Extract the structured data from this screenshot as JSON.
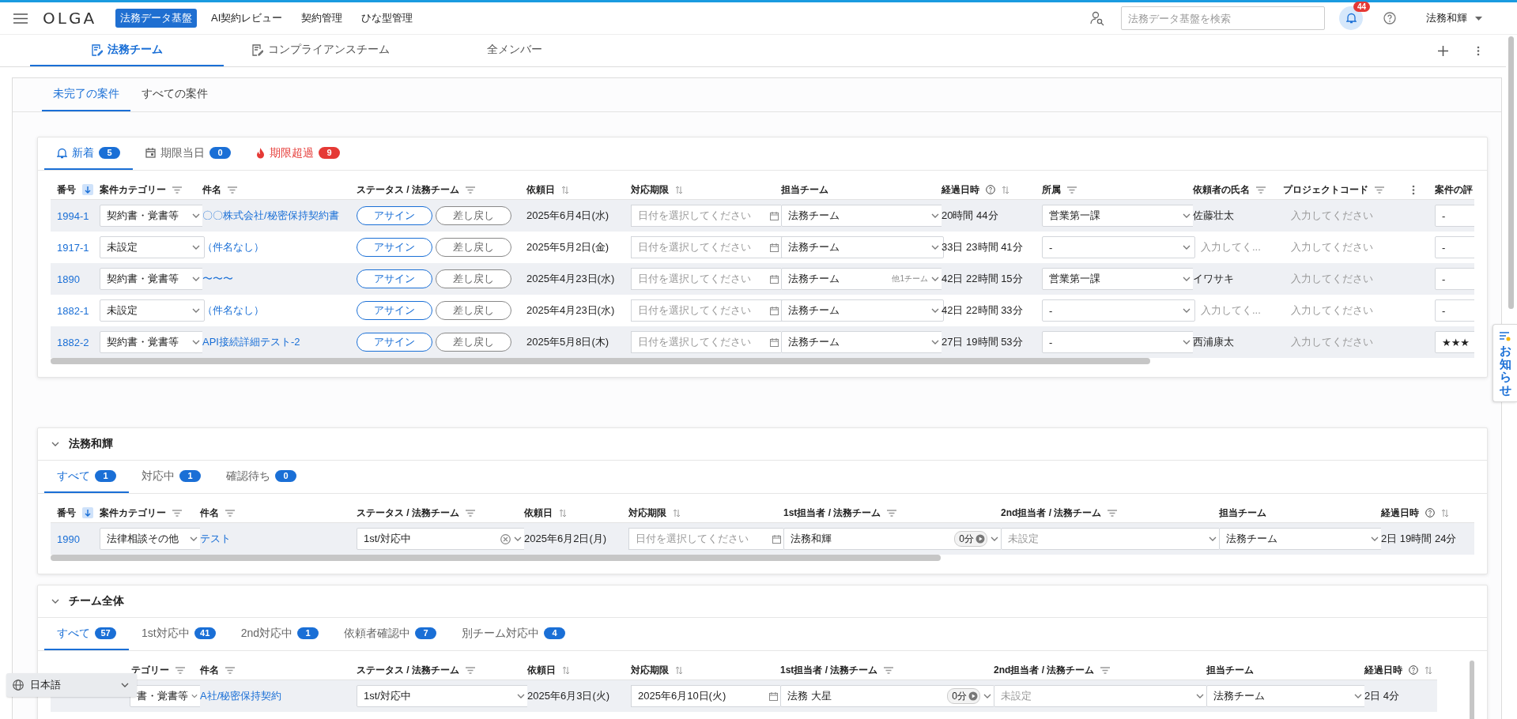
{
  "header": {
    "logo": "OLGA",
    "nav": [
      {
        "label": "法務データ基盤",
        "selected": true
      },
      {
        "label": "AI契約レビュー",
        "selected": false
      },
      {
        "label": "契約管理",
        "selected": false
      },
      {
        "label": "ひな型管理",
        "selected": false
      }
    ],
    "search": {
      "placeholder": "法務データ基盤を検索"
    },
    "notification_count": "44",
    "user": "法務和輝"
  },
  "team_tabs": [
    {
      "label": "法務チーム",
      "selected": true,
      "icon": true
    },
    {
      "label": "コンプライアンスチーム",
      "selected": false,
      "icon": true
    },
    {
      "label": "全メンバー",
      "selected": false,
      "icon": false
    }
  ],
  "view_tabs": [
    {
      "label": "未完了の案件",
      "selected": true
    },
    {
      "label": "すべての案件",
      "selected": false
    }
  ],
  "cards": [
    {
      "tabs": [
        {
          "label": "新着",
          "count": "5",
          "kind": "bell",
          "selected": true
        },
        {
          "label": "期限当日",
          "count": "0",
          "kind": "calendar",
          "selected": false
        },
        {
          "label": "期限超過",
          "count": "9",
          "kind": "overdue",
          "selected": false
        }
      ],
      "columns": [
        {
          "label": "番号",
          "sorted": true
        },
        {
          "label": "案件カテゴリー",
          "filter": true
        },
        {
          "label": "件名",
          "filter": true
        },
        {
          "label": "ステータス / 法務チーム",
          "filter": true
        },
        {
          "label": "依頼日",
          "sortable": true
        },
        {
          "label": "対応期限",
          "sortable": true
        },
        {
          "label": "担当チーム"
        },
        {
          "label": "経過日時",
          "help": true,
          "sortable": true
        },
        {
          "label": "所属",
          "filter": true
        },
        {
          "label": "依頼者の氏名",
          "filter": true
        },
        {
          "label": "プロジェクトコード",
          "filter": true,
          "menu": true
        },
        {
          "label": "案件の評"
        }
      ],
      "rows": [
        {
          "cells": [
            {
              "kind": "link",
              "text": "1994-1"
            },
            {
              "kind": "select",
              "value": "契約書・覚書等"
            },
            {
              "kind": "link",
              "text": "〇〇株式会社/秘密保持契約書"
            },
            {
              "kind": "actions",
              "buttons": [
                {
                  "label": "アサイン",
                  "kind": "primary"
                },
                {
                  "label": "差し戻し",
                  "kind": "secondary"
                }
              ]
            },
            {
              "kind": "text",
              "text": "2025年6月4日(水)"
            },
            {
              "kind": "date",
              "placeholder": "日付を選択してください"
            },
            {
              "kind": "select",
              "value": "法務チーム"
            },
            {
              "kind": "text",
              "text": "20時間 44分"
            },
            {
              "kind": "select",
              "value": "営業第一課"
            },
            {
              "kind": "text",
              "text": "佐藤壮太"
            },
            {
              "kind": "input",
              "placeholder": "入力してください"
            },
            {
              "kind": "select",
              "value": "-"
            }
          ]
        },
        {
          "cells": [
            {
              "kind": "link",
              "text": "1917-1"
            },
            {
              "kind": "select",
              "value": "未設定"
            },
            {
              "kind": "link",
              "text": "（件名なし）"
            },
            {
              "kind": "actions",
              "buttons": [
                {
                  "label": "アサイン",
                  "kind": "primary"
                },
                {
                  "label": "差し戻し",
                  "kind": "secondary"
                }
              ]
            },
            {
              "kind": "text",
              "text": "2025年5月2日(金)"
            },
            {
              "kind": "date",
              "placeholder": "日付を選択してください"
            },
            {
              "kind": "select",
              "value": "法務チーム"
            },
            {
              "kind": "text",
              "text": "33日 23時間 41分"
            },
            {
              "kind": "select",
              "value": "-"
            },
            {
              "kind": "input",
              "placeholder": "入力してく..."
            },
            {
              "kind": "input",
              "placeholder": "入力してください"
            },
            {
              "kind": "select",
              "value": "-"
            }
          ]
        },
        {
          "cells": [
            {
              "kind": "link",
              "text": "1890"
            },
            {
              "kind": "select",
              "value": "契約書・覚書等"
            },
            {
              "kind": "link",
              "text": "〜〜〜"
            },
            {
              "kind": "actions",
              "buttons": [
                {
                  "label": "アサイン",
                  "kind": "primary"
                },
                {
                  "label": "差し戻し",
                  "kind": "secondary"
                }
              ]
            },
            {
              "kind": "text",
              "text": "2025年4月23日(水)"
            },
            {
              "kind": "date",
              "placeholder": "日付を選択してください"
            },
            {
              "kind": "select",
              "value": "法務チーム",
              "extra": "他1チーム"
            },
            {
              "kind": "text",
              "text": "42日 22時間 15分"
            },
            {
              "kind": "select",
              "value": "営業第一課"
            },
            {
              "kind": "text",
              "text": "イワサキ"
            },
            {
              "kind": "input",
              "placeholder": "入力してください"
            },
            {
              "kind": "select",
              "value": "-"
            }
          ]
        },
        {
          "cells": [
            {
              "kind": "link",
              "text": "1882-1"
            },
            {
              "kind": "select",
              "value": "未設定"
            },
            {
              "kind": "link",
              "text": "（件名なし）"
            },
            {
              "kind": "actions",
              "buttons": [
                {
                  "label": "アサイン",
                  "kind": "primary"
                },
                {
                  "label": "差し戻し",
                  "kind": "secondary"
                }
              ]
            },
            {
              "kind": "text",
              "text": "2025年4月23日(水)"
            },
            {
              "kind": "date",
              "placeholder": "日付を選択してください"
            },
            {
              "kind": "select",
              "value": "法務チーム"
            },
            {
              "kind": "text",
              "text": "42日 22時間 33分"
            },
            {
              "kind": "select",
              "value": "-"
            },
            {
              "kind": "input",
              "placeholder": "入力してく..."
            },
            {
              "kind": "input",
              "placeholder": "入力してください"
            },
            {
              "kind": "select",
              "value": "-"
            }
          ]
        },
        {
          "cells": [
            {
              "kind": "link",
              "text": "1882-2"
            },
            {
              "kind": "select",
              "value": "契約書・覚書等"
            },
            {
              "kind": "link",
              "text": "API接続詳細テスト-2"
            },
            {
              "kind": "actions",
              "buttons": [
                {
                  "label": "アサイン",
                  "kind": "primary"
                },
                {
                  "label": "差し戻し",
                  "kind": "secondary"
                }
              ]
            },
            {
              "kind": "text",
              "text": "2025年5月8日(木)"
            },
            {
              "kind": "date",
              "placeholder": "日付を選択してください"
            },
            {
              "kind": "select",
              "value": "法務チーム"
            },
            {
              "kind": "text",
              "text": "27日 19時間 53分"
            },
            {
              "kind": "select",
              "value": "-"
            },
            {
              "kind": "text",
              "text": "西浦康太"
            },
            {
              "kind": "input",
              "placeholder": "入力してください"
            },
            {
              "kind": "select",
              "value": "★★★"
            }
          ]
        }
      ]
    },
    {
      "title": "法務和輝",
      "expanded": true,
      "tabs": [
        {
          "label": "すべて",
          "count": "1",
          "kind": "plain",
          "selected": true
        },
        {
          "label": "対応中",
          "count": "1",
          "kind": "plain",
          "selected": false
        },
        {
          "label": "確認待ち",
          "count": "0",
          "kind": "plain",
          "selected": false
        }
      ],
      "columns": [
        {
          "label": "番号",
          "sorted": true
        },
        {
          "label": "案件カテゴリー",
          "filter": true
        },
        {
          "label": "件名",
          "filter": true
        },
        {
          "label": "ステータス / 法務チーム",
          "filter": true
        },
        {
          "label": "依頼日",
          "sortable": true
        },
        {
          "label": "対応期限",
          "sortable": true
        },
        {
          "label": "1st担当者 / 法務チーム",
          "filter": true
        },
        {
          "label": "2nd担当者 / 法務チーム",
          "filter": true
        },
        {
          "label": "担当チーム"
        },
        {
          "label": "経過日時",
          "help": true,
          "sortable": true
        }
      ],
      "rows": [
        {
          "cells": [
            {
              "kind": "link",
              "text": "1990"
            },
            {
              "kind": "select",
              "value": "法律相談その他"
            },
            {
              "kind": "link",
              "text": "テスト"
            },
            {
              "kind": "select",
              "value": "1st/対応中",
              "status_icon": true
            },
            {
              "kind": "text",
              "text": "2025年6月2日(月)"
            },
            {
              "kind": "date",
              "placeholder": "日付を選択してください"
            },
            {
              "kind": "select",
              "value": "法務和輝",
              "badge": "0分"
            },
            {
              "kind": "select",
              "placeholder": "未設定"
            },
            {
              "kind": "select",
              "value": "法務チーム"
            },
            {
              "kind": "text",
              "text": "2日 19時間 24分"
            }
          ]
        }
      ]
    },
    {
      "title": "チーム全体",
      "expanded": true,
      "tabs": [
        {
          "label": "すべて",
          "count": "57",
          "kind": "plain",
          "selected": true
        },
        {
          "label": "1st対応中",
          "count": "41",
          "kind": "plain",
          "selected": false
        },
        {
          "label": "2nd対応中",
          "count": "1",
          "kind": "plain",
          "selected": false
        },
        {
          "label": "依頼者確認中",
          "count": "7",
          "kind": "plain",
          "selected": false
        },
        {
          "label": "別チーム対応中",
          "count": "4",
          "kind": "plain",
          "selected": false
        }
      ],
      "columns": [
        {},
        {
          "label": "テゴリー",
          "filter": true
        },
        {
          "label": "件名",
          "filter": true
        },
        {
          "label": "ステータス / 法務チーム",
          "filter": true
        },
        {
          "label": "依頼日",
          "sortable": true
        },
        {
          "label": "対応期限",
          "sortable": true
        },
        {
          "label": "1st担当者 / 法務チーム",
          "filter": true
        },
        {
          "label": "2nd担当者 / 法務チーム",
          "filter": true
        },
        {
          "label": "担当チーム"
        },
        {
          "label": "経過日時",
          "help": true,
          "sortable": true
        }
      ],
      "rows": [
        {
          "cells": [
            {
              "kind": "none"
            },
            {
              "kind": "select",
              "value": "書・覚書等"
            },
            {
              "kind": "link",
              "text": "A社/秘密保持契約"
            },
            {
              "kind": "select",
              "value": "1st/対応中"
            },
            {
              "kind": "text",
              "text": "2025年6月3日(火)"
            },
            {
              "kind": "date",
              "value": "2025年6月10日(火)"
            },
            {
              "kind": "select",
              "value": "法務 大星",
              "badge": "0分"
            },
            {
              "kind": "select",
              "placeholder": "未設定"
            },
            {
              "kind": "select",
              "value": "法務チーム"
            },
            {
              "kind": "text",
              "text": "2日 4分"
            }
          ]
        }
      ]
    }
  ],
  "notice_tab": {
    "label": "お知らせ"
  },
  "language": {
    "value": "日本語"
  }
}
